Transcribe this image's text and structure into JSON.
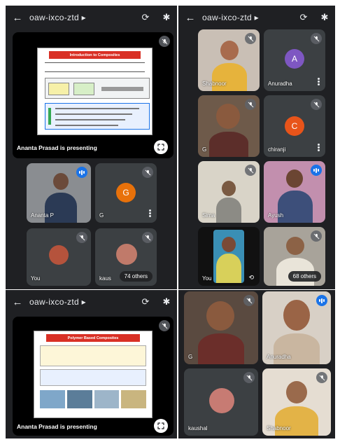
{
  "meeting": {
    "code": "oaw-ixco-ztd",
    "code_arrow": "▸"
  },
  "panel_a": {
    "presenting_label": "Ananta Prasad is presenting",
    "slide_title": "Introduction to Composites",
    "tiles": [
      {
        "name": "Ananta P"
      },
      {
        "name": "G",
        "avatar_letter": "G"
      },
      {
        "name": "You"
      },
      {
        "name": "kaus",
        "others": "74 others"
      }
    ]
  },
  "panel_b": {
    "tiles": [
      {
        "name": "Shabnoor"
      },
      {
        "name": "Anuradha",
        "avatar_letter": "A"
      },
      {
        "name": "G"
      },
      {
        "name": "chiranji",
        "avatar_letter": "C"
      },
      {
        "name": "Sima"
      },
      {
        "name": "Ayush"
      },
      {
        "name": "You"
      },
      {
        "name": "",
        "others": "68 others"
      }
    ]
  },
  "panel_c": {
    "presenting_label": "Ananta Prasad is presenting",
    "slide_title": "Polymer Based Composites"
  },
  "panel_d": {
    "tiles": [
      {
        "name": "G"
      },
      {
        "name": "Anuradha"
      },
      {
        "name": "kaushal"
      },
      {
        "name": "Shabnoor"
      }
    ]
  },
  "colors": {
    "meet_bg": "#1f2023",
    "tile_bg": "#3c4043",
    "speaking_blue": "#1a73e8",
    "avatar_g": "#e8710a",
    "avatar_a": "#7e57c2",
    "avatar_c": "#e8541a",
    "slide_red": "#d93025"
  },
  "icons": [
    "back-arrow-icon",
    "camera-switch-icon",
    "bluetooth-icon",
    "mic-off-icon",
    "speaking-icon",
    "more-vert-icon",
    "fullscreen-icon"
  ]
}
